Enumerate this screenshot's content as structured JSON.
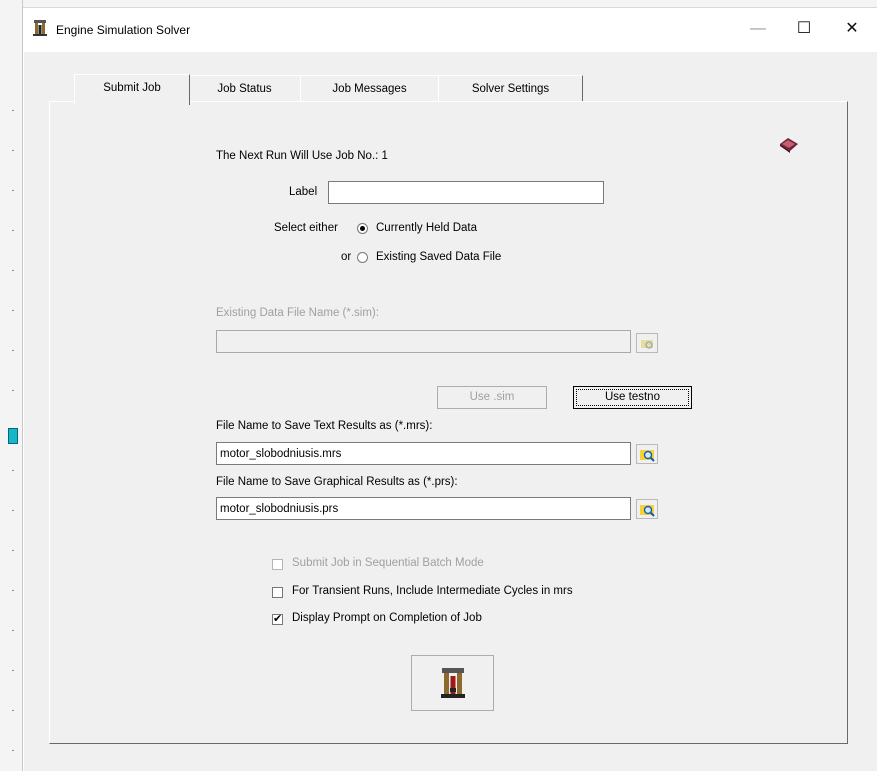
{
  "window": {
    "title": "Engine Simulation Solver",
    "minimize_glyph": "—",
    "maximize_glyph": "☐",
    "close_glyph": "✕"
  },
  "tabs": [
    {
      "label": "Submit Job",
      "active": true
    },
    {
      "label": "Job Status",
      "active": false
    },
    {
      "label": "Job Messages",
      "active": false
    },
    {
      "label": "Solver Settings",
      "active": false
    }
  ],
  "submit": {
    "next_run_text": "The Next Run Will Use Job No.: 1",
    "label_caption": "Label",
    "label_value": "",
    "select_either": "Select either",
    "or": "or",
    "radio_current": "Currently Held Data",
    "radio_existing": "Existing Saved Data File",
    "selected_source": "Currently Held Data",
    "existing_file_label": "Existing Data File Name (*.sim):",
    "existing_file_value": "",
    "use_sim_button": "Use .sim",
    "use_testno_button": "Use testno",
    "text_results_label": "File Name to Save Text Results as (*.mrs):",
    "text_results_value": "motor_slobodniusis.mrs",
    "graph_results_label": "File Name to Save Graphical Results as (*.prs):",
    "graph_results_value": "motor_slobodniusis.prs",
    "chk_sequential": "Submit Job in Sequential Batch Mode",
    "chk_sequential_checked": false,
    "chk_transient": "For Transient Runs, Include Intermediate Cycles in mrs",
    "chk_transient_checked": false,
    "chk_prompt": "Display Prompt on Completion of Job",
    "chk_prompt_checked": true,
    "check_mark": "✔"
  },
  "colors": {
    "background": "#f0f0f0",
    "disabled_text": "#a0a0a0",
    "help_icon": "#7a2036"
  },
  "icons": [
    "app-engine-icon",
    "help-book-icon",
    "browse-folder-icon",
    "run-solver-engine-icon"
  ]
}
